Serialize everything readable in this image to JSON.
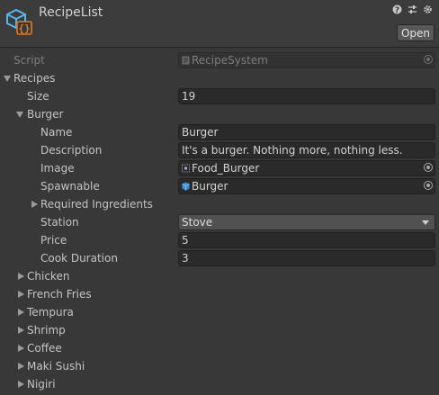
{
  "window": {
    "title": "RecipeList",
    "open_button": "Open"
  },
  "fields": {
    "script": {
      "label": "Script",
      "value": "RecipeSystem"
    },
    "recipes": {
      "label": "Recipes"
    },
    "size": {
      "label": "Size",
      "value": "19"
    },
    "burger": {
      "label": "Burger",
      "name": {
        "label": "Name",
        "value": "Burger"
      },
      "description": {
        "label": "Description",
        "value": "It's a burger. Nothing more, nothing less."
      },
      "image": {
        "label": "Image",
        "value": "Food_Burger"
      },
      "spawnable": {
        "label": "Spawnable",
        "value": "Burger"
      },
      "required_ingredients": {
        "label": "Required Ingredients"
      },
      "station": {
        "label": "Station",
        "value": "Stove"
      },
      "price": {
        "label": "Price",
        "value": "5"
      },
      "cook_duration": {
        "label": "Cook Duration",
        "value": "3"
      }
    }
  },
  "collapsed_recipes": [
    "Chicken",
    "French Fries",
    "Tempura",
    "Shrimp",
    "Coffee",
    "Maki Sushi",
    "Nigiri"
  ],
  "colors": {
    "accent": "#3a8fd6",
    "asset_icon_orange": "#e07a1f"
  }
}
